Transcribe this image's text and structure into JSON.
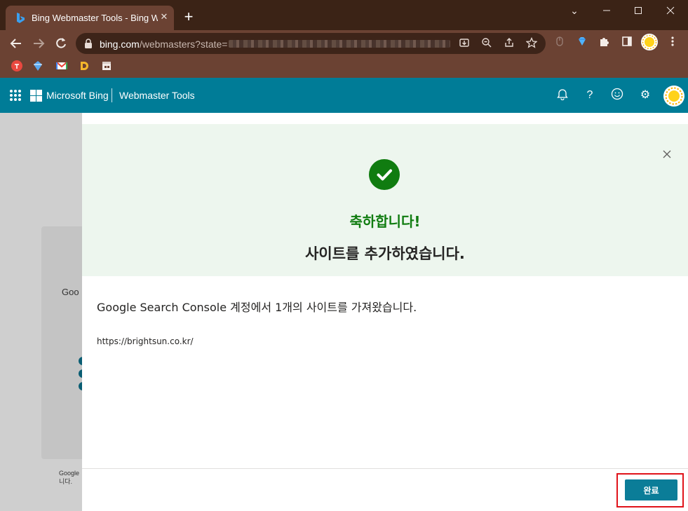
{
  "browser": {
    "tab_title": "Bing Webmaster Tools - Bing W",
    "tab_close": "✕",
    "new_tab": "+",
    "url_host": "bing.com",
    "url_path": "/webmasters?state=",
    "window_buttons": {
      "minimize": "—",
      "maximize": "☐",
      "close": "✕"
    },
    "chevron": "⌄"
  },
  "app": {
    "brand": "Microsoft Bing",
    "product": "Webmaster Tools",
    "header_icons": [
      "bell-icon",
      "help-icon",
      "smiley-icon",
      "settings-icon"
    ],
    "help_glyph": "?",
    "smiley_glyph": "☺",
    "gear_glyph": "⚙"
  },
  "background": {
    "partial_text": "Goo",
    "footnote": "Google 니다."
  },
  "dialog": {
    "congrats": "축하합니다!",
    "added": "사이트를 추가하였습니다.",
    "imported": "Google Search Console 계정에서 1개의 사이트를 가져왔습니다.",
    "site_url": "https://brightsun.co.kr/",
    "done_label": "완료"
  },
  "colors": {
    "accent": "#007c97",
    "success": "#107c10",
    "highlight": "#e0131a",
    "button": "#0b7d98"
  }
}
